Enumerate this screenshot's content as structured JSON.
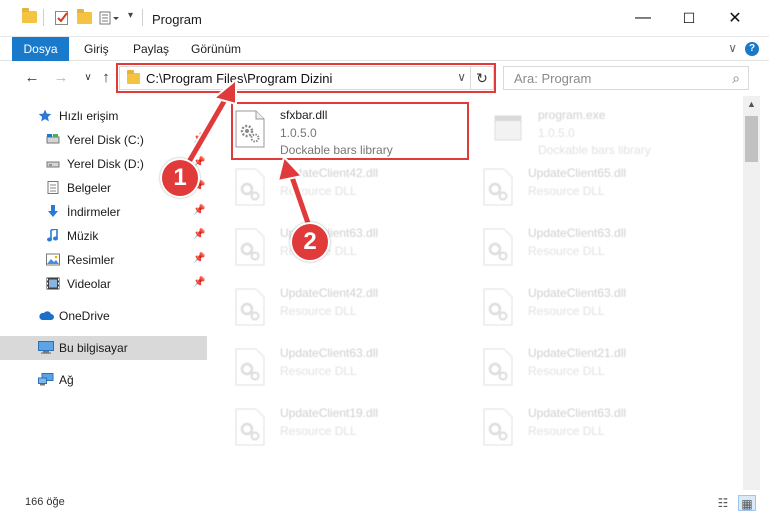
{
  "window": {
    "title": "Program",
    "minimize": "—",
    "maximize": "☐",
    "close": "✕"
  },
  "ribbon": {
    "tabs": [
      "Dosya",
      "Giriş",
      "Paylaş",
      "Görünüm"
    ],
    "collapse_icon": "∨",
    "help_icon": "?"
  },
  "nav": {
    "back": "←",
    "forward": "→",
    "recent": "∨",
    "up": "↑"
  },
  "address": {
    "path": "C:\\Program Files\\Program Dizini",
    "dropdown": "∨",
    "refresh": "↻"
  },
  "search": {
    "placeholder": "Ara: Program",
    "icon": "⌕"
  },
  "sidebar": {
    "items": [
      {
        "label": "Hızlı erişim",
        "icon": "star-icon",
        "pinned": false
      },
      {
        "label": "Yerel Disk (C:)",
        "icon": "drive-icon",
        "pinned": true
      },
      {
        "label": "Yerel Disk (D:)",
        "icon": "drive-icon",
        "pinned": true
      },
      {
        "label": "Belgeler",
        "icon": "documents-icon",
        "pinned": true
      },
      {
        "label": "İndirmeler",
        "icon": "downloads-icon",
        "pinned": true
      },
      {
        "label": "Müzik",
        "icon": "music-icon",
        "pinned": true
      },
      {
        "label": "Resimler",
        "icon": "pictures-icon",
        "pinned": true
      },
      {
        "label": "Videolar",
        "icon": "videos-icon",
        "pinned": true
      },
      {
        "label": "OneDrive",
        "icon": "cloud-icon",
        "pinned": false
      },
      {
        "label": "Bu bilgisayar",
        "icon": "computer-icon",
        "pinned": false,
        "selected": true
      },
      {
        "label": "Ağ",
        "icon": "network-icon",
        "pinned": false
      }
    ],
    "pin_glyph": "📌"
  },
  "files": [
    {
      "name": "sfxbar.dll",
      "line2": "1.0.5.0",
      "line3": "Dockable bars library",
      "highlighted": true
    },
    {
      "name": "program.exe",
      "line2": "1.0.5.0",
      "line3": "Dockable bars library"
    },
    {
      "name": "UpdateClient42.dll",
      "line2": "Resource DLL"
    },
    {
      "name": "UpdateClient65.dll",
      "line2": "Resource DLL"
    },
    {
      "name": "UpdateClient63.dll",
      "line2": "Resource DLL"
    },
    {
      "name": "UpdateClient63.dll",
      "line2": "Resource DLL"
    },
    {
      "name": "UpdateClient42.dll",
      "line2": "Resource DLL"
    },
    {
      "name": "UpdateClient63.dll",
      "line2": "Resource DLL"
    },
    {
      "name": "UpdateClient63.dll",
      "line2": "Resource DLL"
    },
    {
      "name": "UpdateClient21.dll",
      "line2": "Resource DLL"
    },
    {
      "name": "UpdateClient19.dll",
      "line2": "Resource DLL"
    },
    {
      "name": "UpdateClient63.dll",
      "line2": "Resource DLL"
    }
  ],
  "status": {
    "count": "166 öğe",
    "view_details": "☷",
    "view_tiles": "▦"
  },
  "callouts": [
    "1",
    "2"
  ],
  "colors": {
    "accent": "#1979ca",
    "highlight": "#e03a3a",
    "folder": "#f5c342"
  }
}
